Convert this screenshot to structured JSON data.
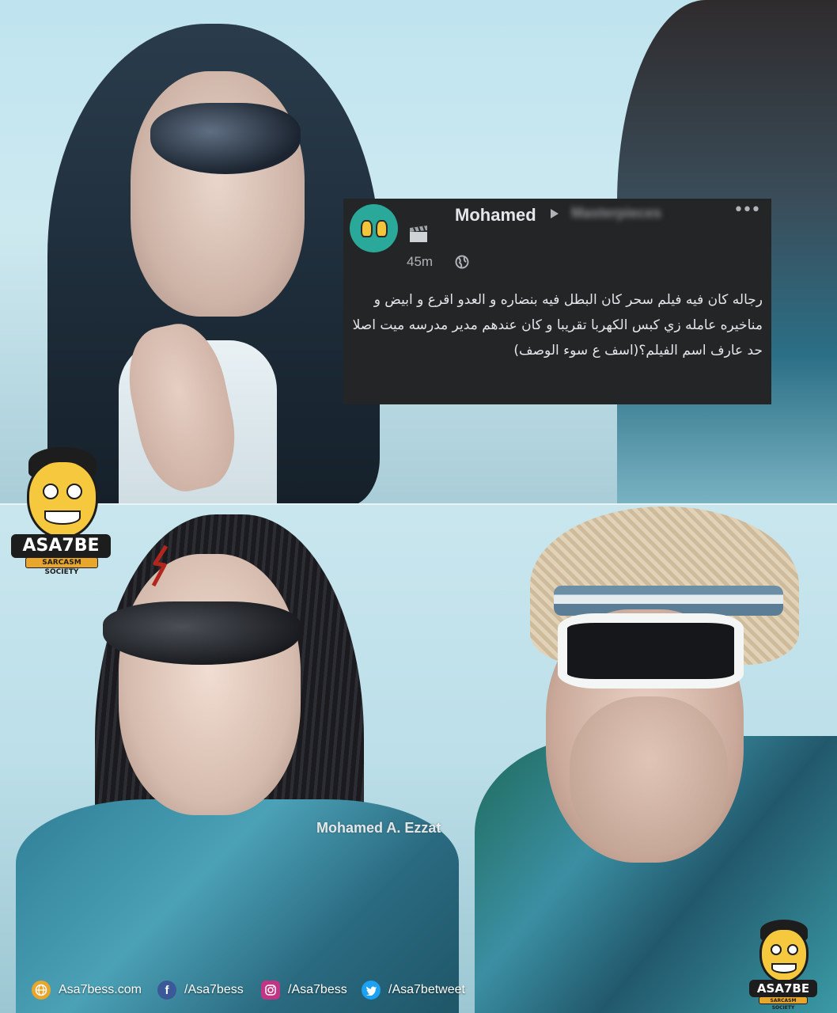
{
  "post": {
    "author": "Mohamed",
    "group": "Masterpieces",
    "time": "45m",
    "more": "•••",
    "text": "رجاله كان فيه فيلم سحر كان البطل فيه بنضاره و العدو اقرع و ابيض و مناخيره عامله زي كبس الكهربا  تقريبا و كان عندهم مدير مدرسه ميت اصلا حد عارف اسم الفيلم؟(اسف ع سوء الوصف)",
    "icons": [
      "avatar",
      "arrow-right-icon",
      "more-icon",
      "clapper-board-icon",
      "globe-icon"
    ],
    "colors": {
      "card": "#242526",
      "text": "#e4e6eb",
      "muted": "#b0b3b8"
    }
  },
  "logo": {
    "title": "ASA7BE",
    "subtitle": "SARCASM SOCIETY"
  },
  "watermark": "Mohamed A. Ezzat",
  "footer": {
    "items": [
      {
        "icon": "globe-icon",
        "label": "Asa7bess.com",
        "color": "#e8a62c"
      },
      {
        "icon": "facebook-icon",
        "label": "/Asa7bess",
        "color": "#3b5998"
      },
      {
        "icon": "instagram-icon",
        "label": "/Asa7bess",
        "color": "#c13584"
      },
      {
        "icon": "twitter-icon",
        "label": "/Asa7betweet",
        "color": "#1da1f2"
      }
    ]
  }
}
